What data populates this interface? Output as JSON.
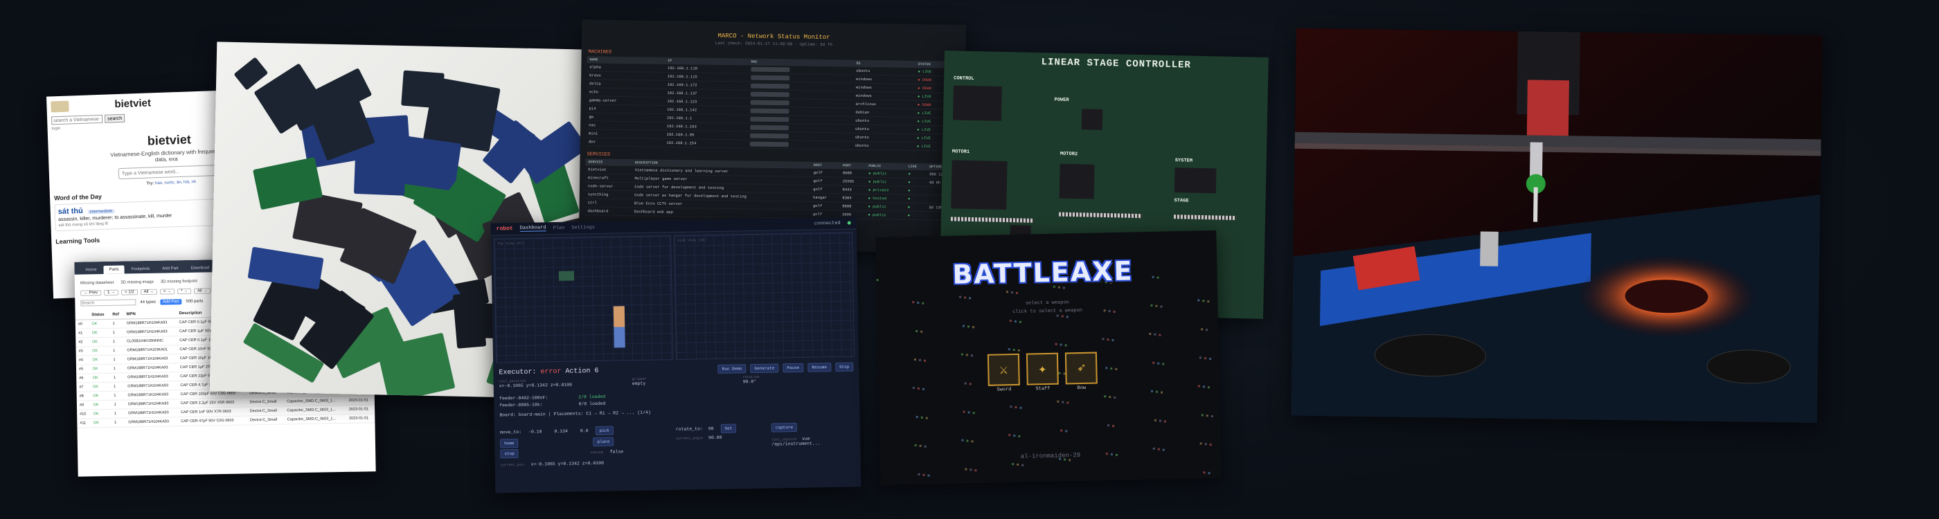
{
  "bietviet": {
    "brand": "bietviet",
    "search_placeholder": "search a Vietnamese w",
    "search_button": "search",
    "nav": "login",
    "title": "bietviet",
    "tagline": "Vietnamese-English dictionary with frequency data, exa",
    "input_placeholder": "Type a Vietnamese word...",
    "try_label": "Try:",
    "try_words": "hào, nước, ăn, hài, nh",
    "wotd_heading": "Word of the Day",
    "wotd_word": "sát thủ",
    "wotd_badge": "intermediate",
    "wotd_def": "assassin, killer, murderer; to assassinate, kill, murder",
    "wotd_example": "sát thủ mang vũ khí lặng lẽ",
    "learning_tools": "Learning Tools"
  },
  "parts": {
    "tabs": [
      "Home",
      "Parts",
      "Footprints",
      "Add Part",
      "Download"
    ],
    "active_tab": "Parts",
    "filters": [
      "Missing datasheet",
      "3D missing image",
      "3D missing footprint"
    ],
    "pills": [
      "← Prev",
      "1 →",
      "< 1/2",
      "All →",
      "< →",
      "* →",
      "All →"
    ],
    "search_placeholder": "Search",
    "count": "44 types",
    "add_button": "Add Part",
    "total": "500 parts",
    "columns": [
      "",
      "Status",
      "Ref",
      "MPN",
      "Description",
      "Symbol",
      "Footprint",
      "Added"
    ],
    "rows": [
      [
        "#0",
        "OK",
        "1",
        "GRM188R71H104KA93",
        "CAP CER 0.1µF 50V X5R 0603",
        "Device:C_Small",
        "Capacitor_SMD:C_0603_1...",
        "2023-01-01"
      ],
      [
        "#1",
        "OK",
        "1",
        "GRM188R71H104KA93",
        "CAP CER 1µF 50V X5R 0603",
        "Device:C_Small",
        "Capacitor_SMD:C_0603_1...",
        "2023-01-01"
      ],
      [
        "#2",
        "OK",
        "1",
        "CL05B104KO5NNNC",
        "CAP CER 0.1µF 16V X5R 0402",
        "Device:C_Small",
        "Capacitor_SMD:C_0402_1...",
        "2023-01-01"
      ],
      [
        "#3",
        "OK",
        "1",
        "GRM188R71H103KA01",
        "CAP CER 10nF 50V X7R 0603",
        "Device:C_Small",
        "Capacitor_SMD:C_0603_1...",
        "2023-01-01"
      ],
      [
        "#4",
        "OK",
        "1",
        "GRM188R71H104KA93",
        "CAP CER 10µF 16V X5R 0603",
        "Device:C_Small",
        "Capacitor_SMD:C_0603_1...",
        "2023-01-01"
      ],
      [
        "#5",
        "OK",
        "1",
        "GRM188R71H104KA93",
        "CAP CER 1µF 25V X5R 0603",
        "Device:C_Small",
        "Capacitor_SMD:C_0603_1...",
        "2023-01-01"
      ],
      [
        "#6",
        "OK",
        "1",
        "GRM188R71H104KA93",
        "CAP CER 22pF 50V C0G 0603",
        "Device:C_Small",
        "Capacitor_SMD:C_0603_1...",
        "2023-01-01"
      ],
      [
        "#7",
        "OK",
        "1",
        "GRM188R71H104KA93",
        "CAP CER 4.7µF 25V X5R 0603",
        "Device:C_Small",
        "Capacitor_SMD:C_0603_1...",
        "2023-01-01"
      ],
      [
        "#8",
        "OK",
        "1",
        "GRM188R71H104KA93",
        "CAP CER 100pF 50V C0G 0603",
        "Device:C_Small",
        "Capacitor_SMD:C_0603_1...",
        "2023-01-01"
      ],
      [
        "#9",
        "OK",
        "1",
        "GRM188R71H104KA93",
        "CAP CER 2.2µF 25V X5R 0603",
        "Device:C_Small",
        "Capacitor_SMD:C_0603_1...",
        "2023-01-01"
      ],
      [
        "#10",
        "OK",
        "1",
        "GRM188R71H104KA93",
        "CAP CER 1nF 50V X7R 0603",
        "Device:C_Small",
        "Capacitor_SMD:C_0603_1...",
        "2023-01-01"
      ],
      [
        "#11",
        "OK",
        "1",
        "GRM188R71H104KA93",
        "CAP CER 47pF 50V C0G 0603",
        "Device:C_Small",
        "Capacitor_SMD:C_0603_1...",
        "2023-01-01"
      ]
    ]
  },
  "netmon": {
    "title": "MARCO - Network Status Monitor",
    "subtitle": "Last check: 2024-01-17 11:58:00 · Uptime: 3d 7h",
    "machines_heading": "MACHINES",
    "machines_cols": [
      "NAME",
      "IP",
      "MAC",
      "OS",
      "STATUS"
    ],
    "machines": [
      [
        "alpha",
        "192.168.1.110",
        "xx:xx:xx:xx:xx:xx",
        "ubuntu",
        "● LIVE"
      ],
      [
        "bravo",
        "192.168.1.115",
        "xx:xx:xx:xx:xx:xx",
        "windows",
        "● DOWN"
      ],
      [
        "delta",
        "192.168.1.172",
        "xx:xx:xx:xx:xx:xx",
        "windows",
        "● DOWN"
      ],
      [
        "echo",
        "192.168.1.137",
        "xx:xx:xx:xx:xx:xx",
        "windows",
        "● LIVE"
      ],
      [
        "gamma-server",
        "192.168.1.123",
        "xx:xx:xx:xx:xx:xx",
        "archlinux",
        "● DOWN"
      ],
      [
        "pi4",
        "192.168.1.142",
        "xx:xx:xx:xx:xx:xx",
        "debian",
        "● LIVE"
      ],
      [
        "gw",
        "192.168.1.1",
        "xx:xx:xx:xx:xx:xx",
        "ubuntu",
        "● LIVE"
      ],
      [
        "nas",
        "192.168.1.163",
        "xx:xx:xx:xx:xx:xx",
        "ubuntu",
        "● LIVE"
      ],
      [
        "mini",
        "192.168.1.99",
        "xx:xx:xx:xx:xx:xx",
        "ubuntu",
        "● LIVE"
      ],
      [
        "dev",
        "192.168.1.154",
        "xx:xx:xx:xx:xx:xx",
        "ubuntu",
        "● LIVE"
      ]
    ],
    "services_heading": "SERVICES",
    "services_cols": [
      "SERVICE",
      "DESCRIPTION",
      "HOST",
      "PORT",
      "PUBLIC",
      "LIVE",
      "UPTIME"
    ],
    "services": [
      [
        "bietviet",
        "Vietnamese dictionary and learning server",
        "golf",
        "8080",
        "● public",
        "●",
        "39d 12h"
      ],
      [
        "minecraft",
        "Multiplayer game server",
        "golf",
        "25565",
        "● public",
        "●",
        "4d 6h"
      ],
      [
        "code-server",
        "Code server for development and testing",
        "golf",
        "8443",
        "● private",
        "●",
        ""
      ],
      [
        "syncthing",
        "Code server as hangar for development and testing",
        "hangar",
        "8384",
        "● hosted",
        "●",
        ""
      ],
      [
        "ctrl",
        "Blue Ecco CCTV server",
        "golf",
        "8888",
        "● public",
        "●",
        "3d 13h"
      ],
      [
        "dashboard",
        "Dashboard web app",
        "golf",
        "3000",
        "● public",
        "●",
        ""
      ]
    ]
  },
  "robot": {
    "brand": "robot",
    "tabs": [
      "Dashboard",
      "Plan",
      "Settings"
    ],
    "active_tab": "Dashboard",
    "connection": "connected",
    "view_a_label": "Top View (XY)",
    "view_b_label": "Side View (XZ)",
    "executor_label": "Executor:",
    "executor_status": "error",
    "action": "Action 6",
    "buttons": [
      "Run Demo",
      "Generate",
      "Pause",
      "Resume",
      "Stop"
    ],
    "position_label": "tool_position",
    "position": "x=-0.1065 y=0.1342 z=0.0100",
    "gripper_label": "gripper",
    "gripper": "empty",
    "angle_label": "rotation",
    "angle": "90.0°",
    "feeder1": "feeder-0402-100nF:",
    "feeder1_status": "2/8 loaded",
    "feeder2": "feeder-0805-10k:",
    "feeder2_status": "0/8 loaded",
    "board_line": "Board: board-main | Placements: C1 → R1 → R2 → ... (1/4)",
    "move_label": "move_to:",
    "move_x": "-0.10",
    "move_y": "0.134",
    "move_z": "0.0",
    "pick_button": "pick",
    "place_button": "place",
    "home_button": "home",
    "stop_button": "stop",
    "vacuum_label": "vacuum",
    "vacuum_value": "false",
    "rotate_label": "rotate_to:",
    "rotate_value": "90",
    "set_button": "Set",
    "current_angle_label": "current_angle",
    "current_angle_value": "90.00",
    "capture_button": "capture",
    "last_capture_label": "last_capture",
    "last_capture_value": "vue /api/instrument...",
    "current_pos_label": "current_pos:",
    "current_pos": "x=-0.1065 y=0.1342 z=0.0100"
  },
  "stage": {
    "title": "LINEAR STAGE CONTROLLER",
    "labels": [
      "CONTROL",
      "POWER",
      "MOTOR1",
      "MOTOR2",
      "SYSTEM",
      "STAGE"
    ]
  },
  "battleaxe": {
    "logo": "BATTLEAXE",
    "line1": "select a weapon",
    "line2": "click to select a weapon",
    "weapons": [
      "Sword",
      "Staff",
      "Bow"
    ],
    "username": "al-ironmaiden-29"
  }
}
